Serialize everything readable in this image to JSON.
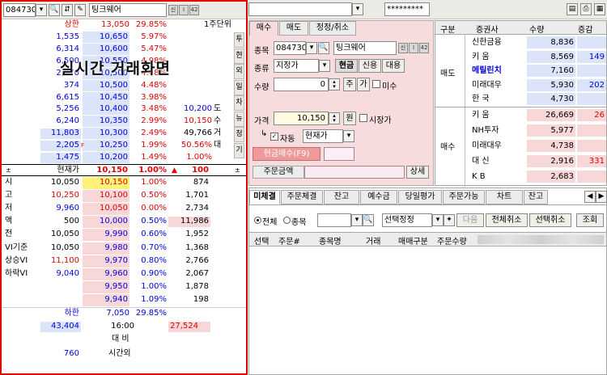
{
  "left": {
    "code": "084730",
    "name": "팅크웨어",
    "mini_btns": [
      "신",
      "I",
      "42"
    ],
    "overlay_title": "실시간 거래화면",
    "header": {
      "upper": "상한",
      "upper_price": "13,050",
      "upper_pct": "29.85%",
      "period": "1주단위"
    },
    "asks": [
      {
        "qty": "1,535",
        "price": "10,650",
        "pct": "5.97%",
        "extra": ""
      },
      {
        "qty": "6,314",
        "price": "10,600",
        "pct": "5.47%",
        "extra": ""
      },
      {
        "qty": "6,500",
        "price": "10,550",
        "pct": "4.98%",
        "extra": ""
      },
      {
        "qty": "2,970",
        "price": "10,500",
        "pct": "4.48%",
        "extra": ""
      },
      {
        "qty": "374",
        "price": "10,500",
        "pct": "4.48%",
        "extra": ""
      },
      {
        "qty": "6,615",
        "price": "10,450",
        "pct": "3.98%",
        "extra": ""
      },
      {
        "qty": "5,256",
        "price": "10,400",
        "pct": "3.48%",
        "extra": "10,200",
        "extra_lbl": "도"
      },
      {
        "qty": "6,240",
        "price": "10,350",
        "pct": "2.99%",
        "extra": "10,150",
        "extra_lbl": "수"
      },
      {
        "qty": "11,803",
        "price": "10,300",
        "pct": "2.49%",
        "extra": "49,766",
        "extra_lbl": "거"
      },
      {
        "qty": "2,205",
        "price": "10,250",
        "pct": "1.99%",
        "extra": "50.56%",
        "extra_lbl": "대"
      },
      {
        "qty": "1,475",
        "price": "10,200",
        "pct": "1.49%",
        "extra": "1.00%",
        "extra_lbl": ""
      }
    ],
    "current": {
      "label": "현재가",
      "price": "10,150",
      "pct": "1.00%",
      "change": "100"
    },
    "bids": [
      {
        "lbl": "시",
        "lv": "10,050",
        "price": "10,150",
        "pct": "1.00%",
        "qty": "874"
      },
      {
        "lbl": "고",
        "lv": "10,250",
        "price": "10,100",
        "pct": "0.50%",
        "qty": "1,701"
      },
      {
        "lbl": "저",
        "lv": "9,960",
        "price": "10,050",
        "pct": "0.00%",
        "qty": "2,734"
      },
      {
        "lbl": "액",
        "lv": "500",
        "price": "10,000",
        "pct": "0.50%",
        "qty": "11,986"
      },
      {
        "lbl": "전",
        "lv": "10,050",
        "price": "9,990",
        "pct": "0.60%",
        "qty": "1,952"
      },
      {
        "lbl": "VI기준",
        "lv": "10,050",
        "price": "9,980",
        "pct": "0.70%",
        "qty": "1,368"
      },
      {
        "lbl": "상승VI",
        "lv": "11,100",
        "price": "9,970",
        "pct": "0.80%",
        "qty": "2,766"
      },
      {
        "lbl": "하락VI",
        "lv": "9,040",
        "price": "9,960",
        "pct": "0.90%",
        "qty": "2,067"
      },
      {
        "lbl": "",
        "lv": "",
        "price": "9,950",
        "pct": "1.00%",
        "qty": "1,878"
      },
      {
        "lbl": "",
        "lv": "",
        "price": "9,940",
        "pct": "1.09%",
        "qty": "198"
      }
    ],
    "lower": {
      "label": "하한",
      "price": "7,050",
      "pct": "29.85%"
    },
    "footer": {
      "ask_total": "43,404",
      "time": "16:00",
      "bid_total": "27,524",
      "compare": "대 비",
      "after_qty": "760",
      "after": "시간외"
    },
    "side_tabs": [
      "투",
      "현",
      "외",
      "일",
      "차",
      "뉴",
      "청",
      "기"
    ]
  },
  "top": {
    "account": "*********"
  },
  "order": {
    "tabs": [
      "매수",
      "매도",
      "정정/취소"
    ],
    "code_lbl": "종목",
    "code": "084730",
    "name": "팅크웨어",
    "type_lbl": "종류",
    "type": "지정가",
    "kinds": [
      "현금",
      "신용",
      "대용"
    ],
    "qty_lbl": "수량",
    "qty": "0",
    "qty_btns": [
      "주",
      "가"
    ],
    "misu": "미수",
    "price_lbl": "가격",
    "price": "10,150",
    "won": "원",
    "market": "시장가",
    "auto": "자동",
    "auto_val": "현재가",
    "buy_btn": "현금매수(F9)",
    "amount_lbl": "주문금액",
    "detail": "상세"
  },
  "broker": {
    "headers": [
      "구분",
      "증권사",
      "수량",
      "증감"
    ],
    "sell_lbl": "매도",
    "buy_lbl": "매수",
    "sell_rows": [
      {
        "name": "신한금융",
        "qty": "8,836",
        "diff": ""
      },
      {
        "name": "키 움",
        "qty": "8,569",
        "diff": "149"
      },
      {
        "name": "메릴린치",
        "qty": "7,160",
        "diff": ""
      },
      {
        "name": "미래대우",
        "qty": "5,930",
        "diff": "202"
      },
      {
        "name": "한 국",
        "qty": "4,730",
        "diff": ""
      }
    ],
    "buy_rows": [
      {
        "name": "키 움",
        "qty": "26,669",
        "diff": "26"
      },
      {
        "name": "NH투자",
        "qty": "5,977",
        "diff": ""
      },
      {
        "name": "미래대우",
        "qty": "4,738",
        "diff": ""
      },
      {
        "name": "대 신",
        "qty": "2,916",
        "diff": "331"
      },
      {
        "name": "K B",
        "qty": "2,683",
        "diff": ""
      }
    ]
  },
  "bottom": {
    "tabs": [
      "미체결",
      "주문체결",
      "잔고",
      "예수금",
      "당일평가",
      "주문가능",
      "차트",
      "잔고"
    ],
    "radio_all": "전체",
    "radio_item": "종목",
    "select_lbl": "선택정정",
    "next": "다음",
    "btn_all_cancel": "전체취소",
    "btn_sel_cancel": "선택취소",
    "btn_query": "조회",
    "cols": [
      "선택",
      "주문#",
      "종목명",
      "거래",
      "매매구분",
      "주문수량"
    ]
  }
}
